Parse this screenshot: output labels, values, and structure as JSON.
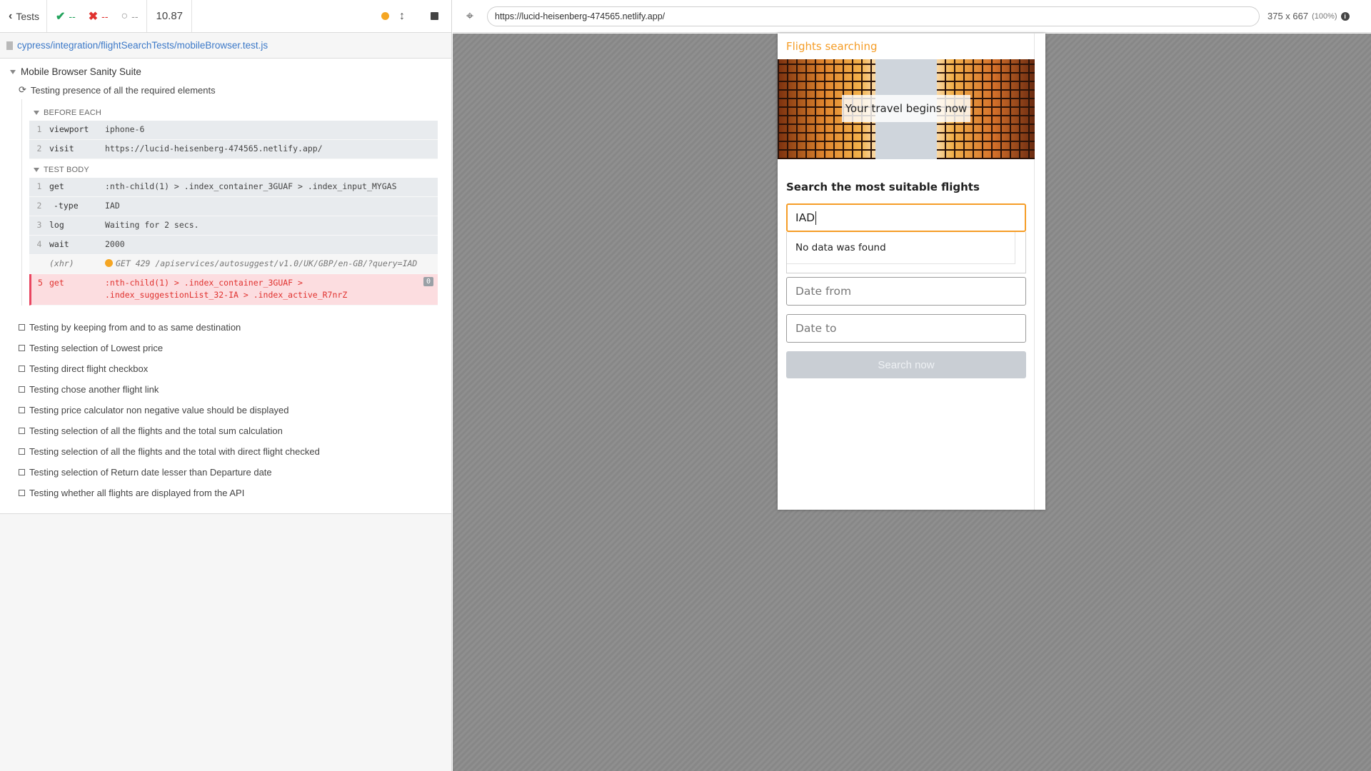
{
  "reporter": {
    "back_label": "Tests",
    "passed_count": "--",
    "failed_count": "--",
    "pending_count": "--",
    "duration": "10.87",
    "spec_path": "cypress/integration/flightSearchTests/mobileBrowser.test.js",
    "suite_title": "Mobile Browser Sanity Suite",
    "running_test": "Testing presence of all the required elements",
    "before_each_label": "BEFORE EACH",
    "before_each": [
      {
        "num": "1",
        "name": "viewport",
        "message": "iphone-6"
      },
      {
        "num": "2",
        "name": "visit",
        "message": "https://lucid-heisenberg-474565.netlify.app/"
      }
    ],
    "test_body_label": "TEST BODY",
    "test_body": [
      {
        "num": "1",
        "name": "get",
        "message": ":nth-child(1) > .index_container_3GUAF > .index_input_MYGAS"
      },
      {
        "num": "2",
        "name": "-type",
        "message": "IAD"
      },
      {
        "num": "3",
        "name": "log",
        "message": "Waiting for 2 secs."
      },
      {
        "num": "4",
        "name": "wait",
        "message": "2000"
      }
    ],
    "xhr": {
      "name": "(xhr)",
      "message": "GET 429 /apiservices/autosuggest/v1.0/UK/GBP/en-GB/?query=IAD"
    },
    "failed_cmd": {
      "num": "5",
      "name": "get",
      "message": ":nth-child(1) > .index_container_3GUAF >\n.index_suggestionList_32-IA > .index_active_R7nrZ",
      "count": "0"
    },
    "tests": [
      "Testing by keeping from and to as same destination",
      "Testing selection of Lowest price",
      "Testing direct flight checkbox",
      "Testing chose another flight link",
      "Testing price calculator non negative value should be displayed",
      "Testing selection of all the flights and the total sum calculation",
      "Testing selection of all the flights and the total with direct flight checked",
      "Testing selection of Return date lesser than Departure date",
      "Testing whether all flights are displayed from the API"
    ]
  },
  "aut": {
    "url": "https://lucid-heisenberg-474565.netlify.app/",
    "viewport_size": "375 x 667",
    "viewport_scale": "(100%)"
  },
  "app": {
    "title": "Flights searching",
    "hero_caption": "Your travel begins now",
    "heading": "Search the most suitable flights",
    "from_value": "IAD",
    "suggestion_text": "No data was found",
    "date_from_placeholder": "Date from",
    "date_to_placeholder": "Date to",
    "search_button": "Search now"
  },
  "colors": {
    "accent": "#f59d27",
    "pass": "#22a35c",
    "fail": "#e0312e",
    "link": "#3c79c8"
  }
}
